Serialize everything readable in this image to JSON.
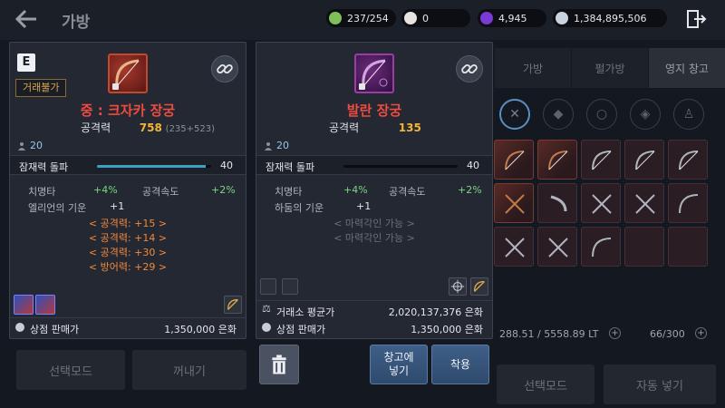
{
  "header": {
    "title": "가방",
    "currencies": [
      {
        "name": "energy",
        "value": "237/254",
        "color": "#7fbf5a"
      },
      {
        "name": "pearl",
        "value": "0",
        "color": "#e8e3e0"
      },
      {
        "name": "crystal",
        "value": "4,945",
        "color": "#7a3ad6"
      },
      {
        "name": "silver",
        "value": "1,384,895,506",
        "color": "#c9d2e0"
      }
    ]
  },
  "tabs": [
    "가방",
    "펄가방",
    "영지 창고"
  ],
  "inventory": {
    "weight": "288.51 / 5558.89 LT",
    "slots": "66/300"
  },
  "bg_buttons": {
    "left_select": "선택모드",
    "left_take": "꺼내기",
    "right_select": "선택모드",
    "right_auto": "자동 넣기"
  },
  "left_card": {
    "grade": "E",
    "trade_tag": "거래불가",
    "name": "중 : 크자카 장궁",
    "atk_label": "공격력",
    "atk_value": "758",
    "atk_sub": "(235+523)",
    "enhance": "20",
    "potential_label": "잠재력 돌파",
    "potential_value": "40",
    "potential_fill": 0.95,
    "stats": {
      "crit_label": "치명타",
      "crit_value": "+4%",
      "speed_label": "공격속도",
      "speed_value": "+2%",
      "extra_label": "엘리언의 기운",
      "extra_value": "+1"
    },
    "enchants": [
      "< 공격력: +15 >",
      "< 공격력: +14 >",
      "< 공격력: +30 >",
      "< 방어력: +29 >"
    ],
    "shop_label": "상점 판매가",
    "shop_value": "1,350,000 은화"
  },
  "right_card": {
    "name": "발란 장궁",
    "atk_label": "공격력",
    "atk_value": "135",
    "enhance": "20",
    "potential_label": "잠재력 돌파",
    "potential_value": "40",
    "potential_fill": 0.0,
    "stats": {
      "crit_label": "치명타",
      "crit_value": "+4%",
      "speed_label": "공격속도",
      "speed_value": "+2%",
      "extra_label": "하둠의 기운",
      "extra_value": "+1"
    },
    "enchants": [
      "< 마력각인 가능 >",
      "< 마력각인 가능 >"
    ],
    "market_label": "거래소 평균가",
    "market_value": "2,020,137,376 은화",
    "shop_label": "상점 판매가",
    "shop_value": "1,350,000 은화"
  },
  "actions": {
    "store": "창고에\n넣기",
    "equip": "착용"
  }
}
